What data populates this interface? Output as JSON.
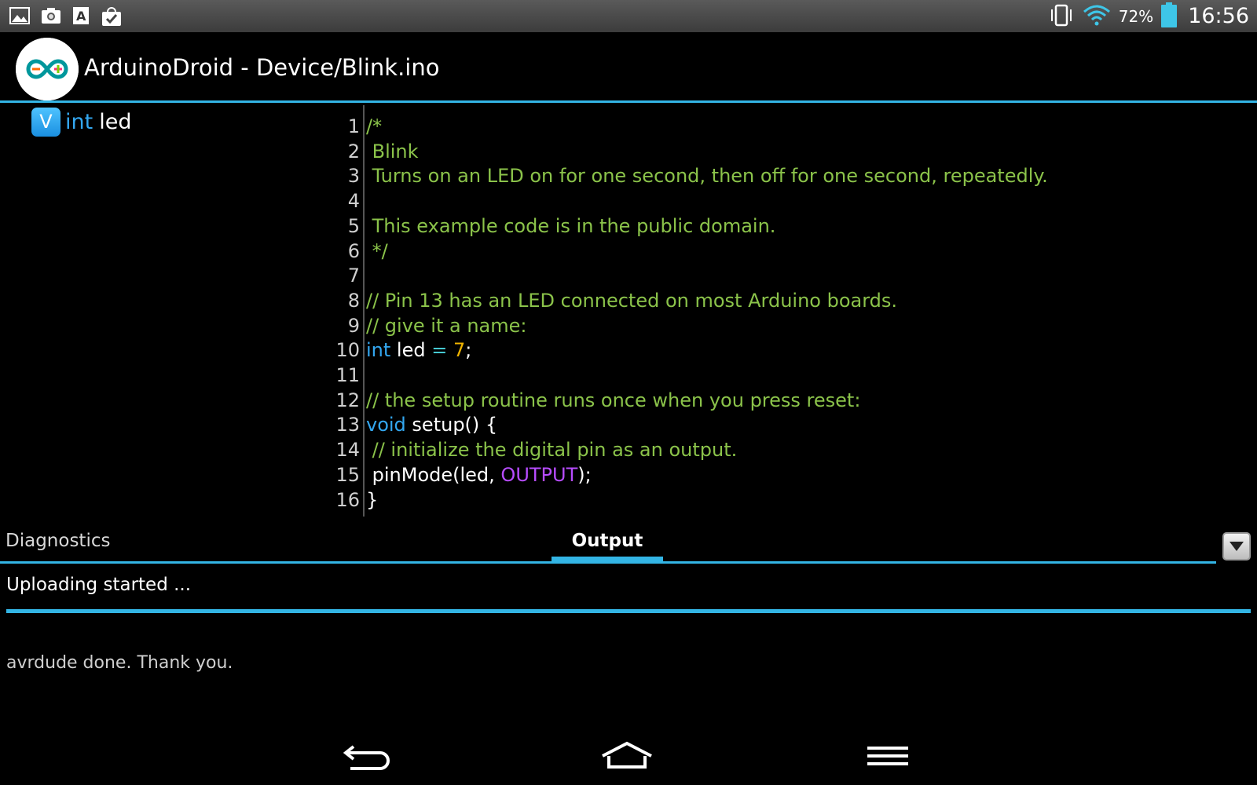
{
  "status_bar": {
    "battery_percent": "72%",
    "clock": "16:56",
    "left_icons": [
      "gallery-icon",
      "camera-icon",
      "font-icon",
      "shopping-bag-icon"
    ],
    "right_icons": [
      "vibrate-icon",
      "wifi-icon",
      "battery-icon"
    ]
  },
  "action_bar": {
    "title": "ArduinoDroid - Device/Blink.ino"
  },
  "outline": {
    "items": [
      {
        "badge": "V",
        "type": "int",
        "name": "led"
      }
    ]
  },
  "editor": {
    "lines": [
      {
        "n": "1",
        "tokens": [
          {
            "t": "/*",
            "c": "comment"
          }
        ]
      },
      {
        "n": "2",
        "tokens": [
          {
            "t": " Blink",
            "c": "comment"
          }
        ]
      },
      {
        "n": "3",
        "tokens": [
          {
            "t": " Turns on an LED on for one second, then off for one second, repeatedly.",
            "c": "comment"
          }
        ]
      },
      {
        "n": "4",
        "tokens": []
      },
      {
        "n": "5",
        "tokens": [
          {
            "t": " This example code is in the public domain.",
            "c": "comment"
          }
        ]
      },
      {
        "n": "6",
        "tokens": [
          {
            "t": " */",
            "c": "comment"
          }
        ]
      },
      {
        "n": "7",
        "tokens": []
      },
      {
        "n": "8",
        "tokens": [
          {
            "t": "// Pin 13 has an LED connected on most Arduino boards.",
            "c": "comment"
          }
        ]
      },
      {
        "n": "9",
        "tokens": [
          {
            "t": "// give it a name:",
            "c": "comment"
          }
        ]
      },
      {
        "n": "10",
        "tokens": [
          {
            "t": "int",
            "c": "kw"
          },
          {
            "t": " led ",
            "c": "plain"
          },
          {
            "t": "=",
            "c": "op"
          },
          {
            "t": " ",
            "c": "plain"
          },
          {
            "t": "7",
            "c": "num"
          },
          {
            "t": ";",
            "c": "plain"
          }
        ]
      },
      {
        "n": "11",
        "tokens": []
      },
      {
        "n": "12",
        "tokens": [
          {
            "t": "// the setup routine runs once when you press reset:",
            "c": "comment"
          }
        ]
      },
      {
        "n": "13",
        "tokens": [
          {
            "t": "void",
            "c": "kw"
          },
          {
            "t": " setup() {",
            "c": "plain"
          }
        ]
      },
      {
        "n": "14",
        "tokens": [
          {
            "t": " // initialize the digital pin as an output.",
            "c": "comment"
          }
        ]
      },
      {
        "n": "15",
        "tokens": [
          {
            "t": " pinMode(led, ",
            "c": "plain"
          },
          {
            "t": "OUTPUT",
            "c": "const"
          },
          {
            "t": ");",
            "c": "plain"
          }
        ]
      },
      {
        "n": "16",
        "tokens": [
          {
            "t": "}",
            "c": "plain"
          }
        ]
      }
    ]
  },
  "tabs": {
    "diagnostics": "Diagnostics",
    "output": "Output",
    "active": "output"
  },
  "output": {
    "status": "Uploading started ...",
    "progress": 1.0,
    "log": "avrdude done.  Thank you."
  },
  "navbar": {
    "buttons": [
      "back-icon",
      "home-icon",
      "menu-icon"
    ]
  },
  "colors": {
    "accent": "#33b5e5",
    "comment": "#8bc34a",
    "keyword": "#33a7f0",
    "number": "#f0b400",
    "constant": "#b74cff"
  }
}
